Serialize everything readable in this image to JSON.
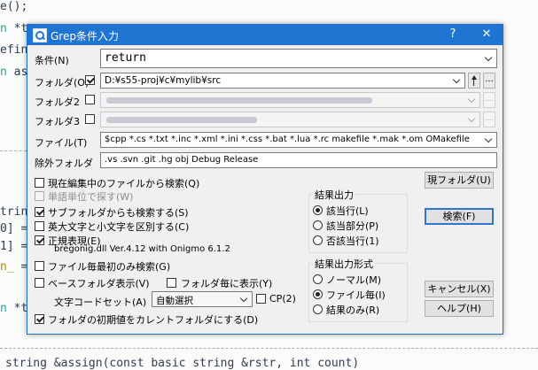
{
  "background": {
    "lines": [
      {
        "pre": "e();",
        "kw": "",
        "post": ""
      },
      {
        "pre": "",
        "kw": "n",
        "post": " *t"
      },
      {
        "pre": "efin",
        "kw": "",
        "post": ""
      },
      {
        "pre": "",
        "kw": "n",
        "post": " as"
      },
      {
        "pre": "trin",
        "kw": "",
        "post": ""
      },
      {
        "pre": "0] =",
        "kw": "",
        "post": ""
      },
      {
        "pre": "1] =",
        "kw": "",
        "post": ""
      },
      {
        "pre": "",
        "kw": "n_",
        "post": " ="
      },
      {
        "pre": "",
        "kw": "n",
        "post": " *t"
      }
    ],
    "bottom_line": "string &assign(const basic string &rstr, int count)"
  },
  "dialog": {
    "title": "Grep条件入力",
    "help_btn": "?",
    "close_btn": "✕",
    "condition": {
      "label": "条件(N)",
      "value": "return"
    },
    "folder": {
      "label": "フォルダ(O)",
      "checked": true,
      "value": "D:¥s55-proj¥c¥mylib¥src",
      "up_btn": "↑",
      "browse_btn": "..."
    },
    "folder2": {
      "label": "フォルダ2",
      "checked": false,
      "browse_btn": "..."
    },
    "folder3": {
      "label": "フォルダ3",
      "checked": false,
      "browse_btn": "..."
    },
    "file": {
      "label": "ファイル(T)",
      "value": "$cpp *.cs *.txt *.inc *.xml *.ini *.css *.bat *.lua *.rc makefile *.mak *.om OMakefile"
    },
    "exclude": {
      "label": "除外フォルダ",
      "value": ".vs .svn .git .hg obj Debug Release"
    },
    "current_folder_btn": "現フォルダ(U)",
    "search_btn": "検索(F)",
    "cancel_btn": "キャンセル(X)",
    "help_btn2": "ヘルプ(H)",
    "options": {
      "current_file": {
        "label": "現在編集中のファイルから検索(Q)",
        "checked": false
      },
      "word": {
        "label": "単語単位で探す(W)",
        "checked": false,
        "disabled": true
      },
      "subfolder": {
        "label": "サブフォルダからも検索する(S)",
        "checked": true
      },
      "case": {
        "label": "英大文字と小文字を区別する(C)",
        "checked": false
      },
      "regex": {
        "label": "正規表現(E)",
        "checked": true
      },
      "regex_lib": "bregonig.dll Ver.4.12 with Onigmo 6.1.2",
      "first_match": {
        "label": "ファイル毎最初のみ検索(G)",
        "checked": false
      },
      "base_folder": {
        "label": "ベースフォルダ表示(V)",
        "checked": false
      },
      "per_folder": {
        "label": "フォルダ毎に表示(Y)",
        "checked": false
      },
      "charset_label": "文字コードセット(A)",
      "charset_value": "自動選択",
      "cp": {
        "label": "CP(2)",
        "checked": false
      },
      "initial_folder": {
        "label": "フォルダの初期値をカレントフォルダにする(D)",
        "checked": true
      }
    },
    "result_output": {
      "title": "結果出力",
      "items": [
        {
          "label": "該当行(L)",
          "checked": true
        },
        {
          "label": "該当部分(P)",
          "checked": false
        },
        {
          "label": "否該当行(1)",
          "checked": false
        }
      ]
    },
    "result_format": {
      "title": "結果出力形式",
      "items": [
        {
          "label": "ノーマル(M)",
          "checked": false
        },
        {
          "label": "ファイル毎(I)",
          "checked": true
        },
        {
          "label": "結果のみ(R)",
          "checked": false
        }
      ]
    }
  }
}
